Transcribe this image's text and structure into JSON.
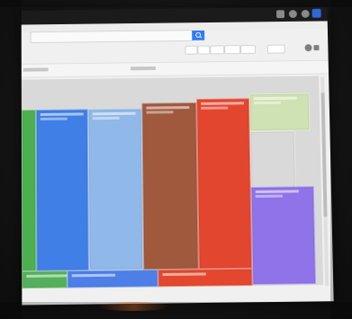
{
  "photo": {
    "screen_content": {
      "top_bar": {
        "icons": [
          "grid-icon",
          "gear-icon",
          "help-icon",
          "avatar"
        ],
        "colors": {
          "search_button": "#2f79ff",
          "avatar": "#2d6ad8"
        }
      },
      "treemap": {
        "tiles": [
          {
            "name": "green-tile",
            "color": "#4caf50"
          },
          {
            "name": "blue-tile",
            "color": "#3f7fe6"
          },
          {
            "name": "light-blue-tile",
            "color": "#90b8e8"
          },
          {
            "name": "brown-tile",
            "color": "#a0593d"
          },
          {
            "name": "red-tile-main",
            "color": "#e3462f"
          },
          {
            "name": "light-green-tile",
            "color": "#cfe2b3"
          },
          {
            "name": "purple-tile",
            "color": "#8f73e8"
          },
          {
            "name": "green-tile-bottom",
            "color": "#54b05a"
          },
          {
            "name": "blue-tile-bottom",
            "color": "#4d7fe7"
          },
          {
            "name": "red-tile-bottom",
            "color": "#e3472d"
          }
        ]
      }
    }
  }
}
